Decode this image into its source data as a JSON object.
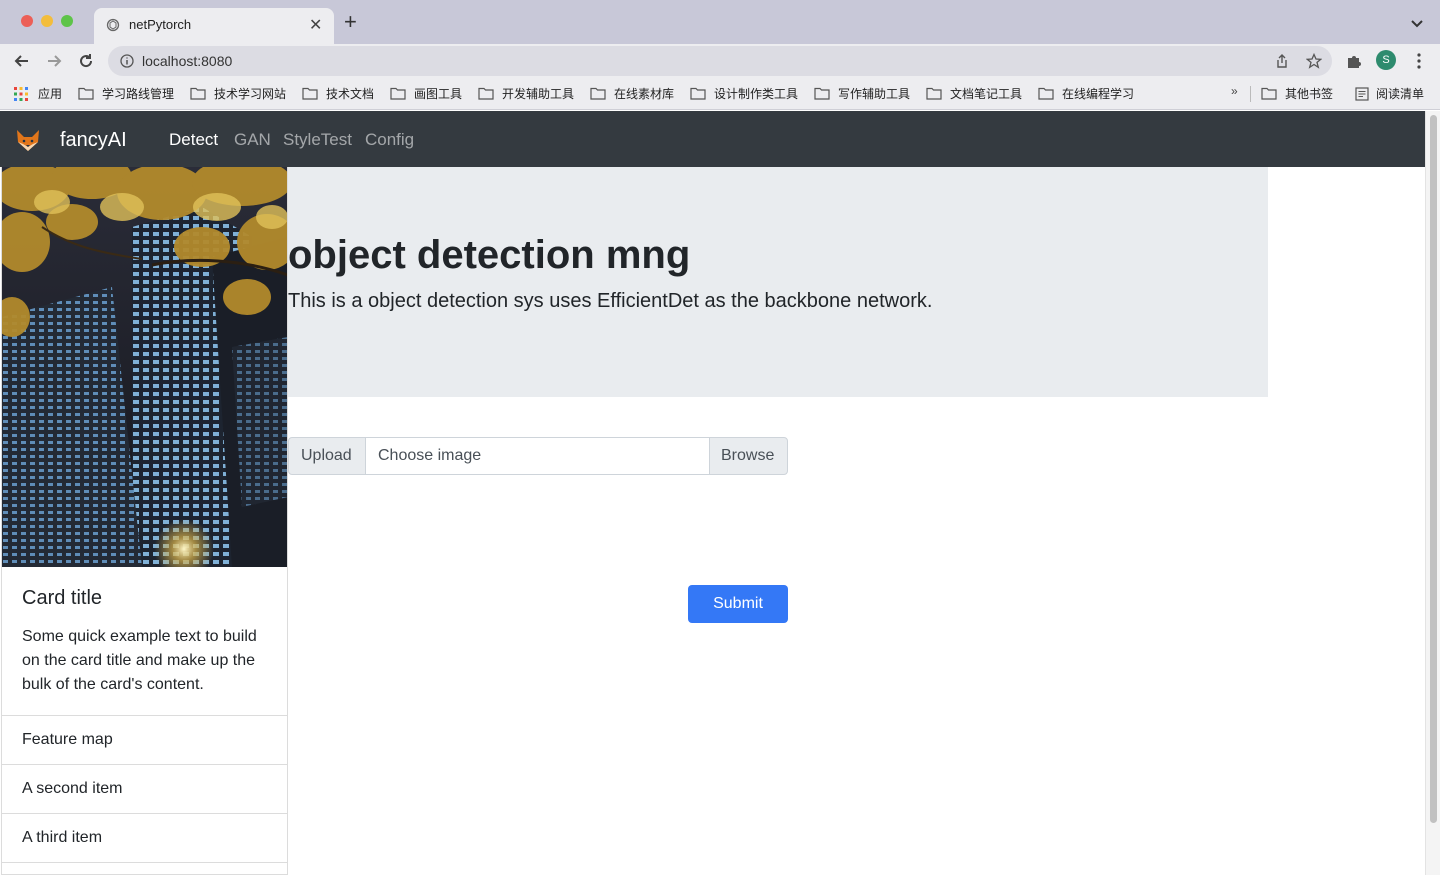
{
  "browser": {
    "tab_title": "netPytorch",
    "url": "localhost:8080",
    "profile_initial": "S",
    "bookmarks": [
      "应用",
      "学习路线管理",
      "技术学习网站",
      "技术文档",
      "画图工具",
      "开发辅助工具",
      "在线素材库",
      "设计制作类工具",
      "写作辅助工具",
      "文档笔记工具",
      "在线编程学习"
    ],
    "more_label": "»",
    "other_bookmarks": "其他书签",
    "reading_list": "阅读清单"
  },
  "navbar": {
    "brand": "fancyAI",
    "links": [
      "Detect",
      "GAN",
      "StyleTest",
      "Config"
    ],
    "active": "Detect"
  },
  "card": {
    "title": "Card title",
    "text": "Some quick example text to build on the card title and make up the bulk of the card's content.",
    "items": [
      "Feature map",
      "A second item",
      "A third item"
    ]
  },
  "jumbotron": {
    "heading": "object detection mng",
    "lead": "This is a object detection sys uses EfficientDet as the backbone network."
  },
  "upload": {
    "prepend_label": "Upload",
    "file_placeholder": "Choose image",
    "browse_label": "Browse"
  },
  "submit_label": "Submit"
}
